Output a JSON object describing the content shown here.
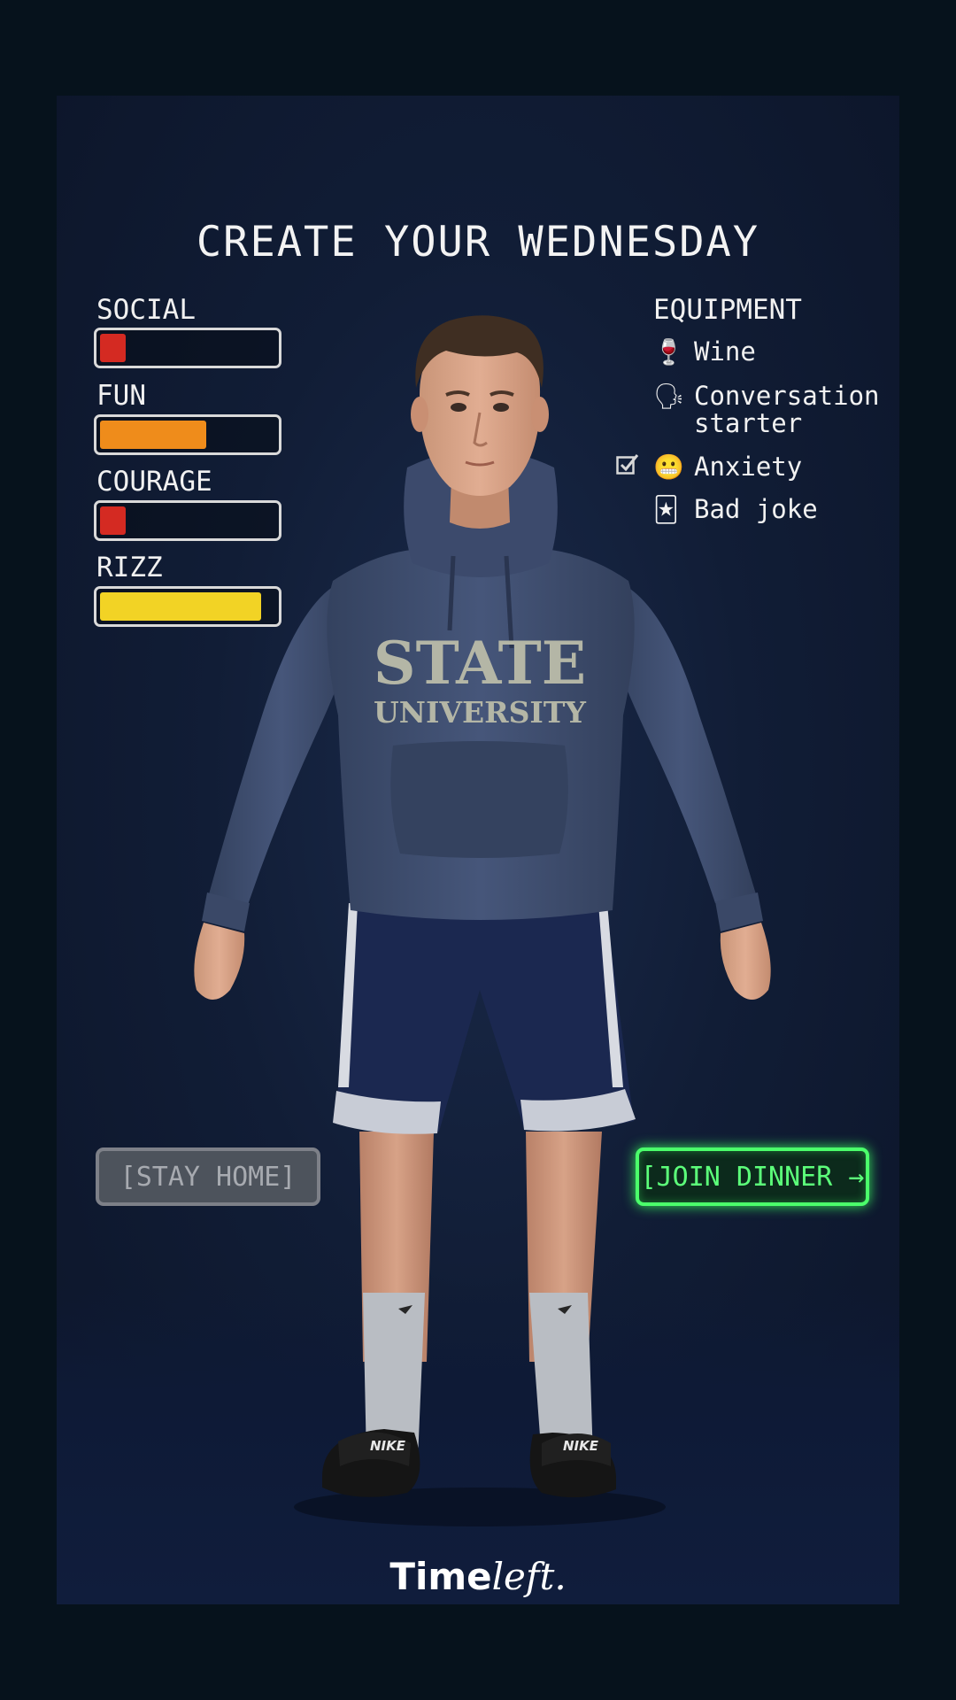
{
  "title": "CREATE YOUR WEDNESDAY",
  "stats": [
    {
      "label": "SOCIAL",
      "level": 0.18,
      "color": "#d42a22"
    },
    {
      "label": "FUN",
      "level": 0.62,
      "color": "#ef8c1b"
    },
    {
      "label": "COURAGE",
      "level": 0.18,
      "color": "#d42a22"
    },
    {
      "label": "RIZZ",
      "level": 0.92,
      "color": "#f2d325"
    }
  ],
  "equipment": {
    "title": "EQUIPMENT",
    "items": [
      {
        "emoji": "🍷",
        "icon": "wine-glass-icon",
        "label": "Wine",
        "checked": false
      },
      {
        "emoji": "🗣",
        "icon": "speaking-head-icon",
        "label_line1": "Conversation",
        "label_line2": "starter",
        "checked": false
      },
      {
        "emoji": "😬",
        "icon": "grimacing-face-icon",
        "label": "Anxiety",
        "checked": true
      },
      {
        "emoji": "🃏",
        "icon": "joker-card-icon",
        "label": "Bad joke",
        "checked": false
      }
    ]
  },
  "character": {
    "hoodie_line1": "STATE",
    "hoodie_line2": "UNIVERSITY",
    "slide_brand": "NIKE",
    "hoodie_color": "#3c4a6c",
    "shorts_color": "#1b2850"
  },
  "buttons": {
    "stay_home": "[STAY HOME]",
    "join_dinner": "[JOIN DINNER →"
  },
  "brand": {
    "part1": "Time",
    "part2": "left."
  },
  "colors": {
    "background": "#06121c",
    "accent_green": "#4bff6b"
  }
}
